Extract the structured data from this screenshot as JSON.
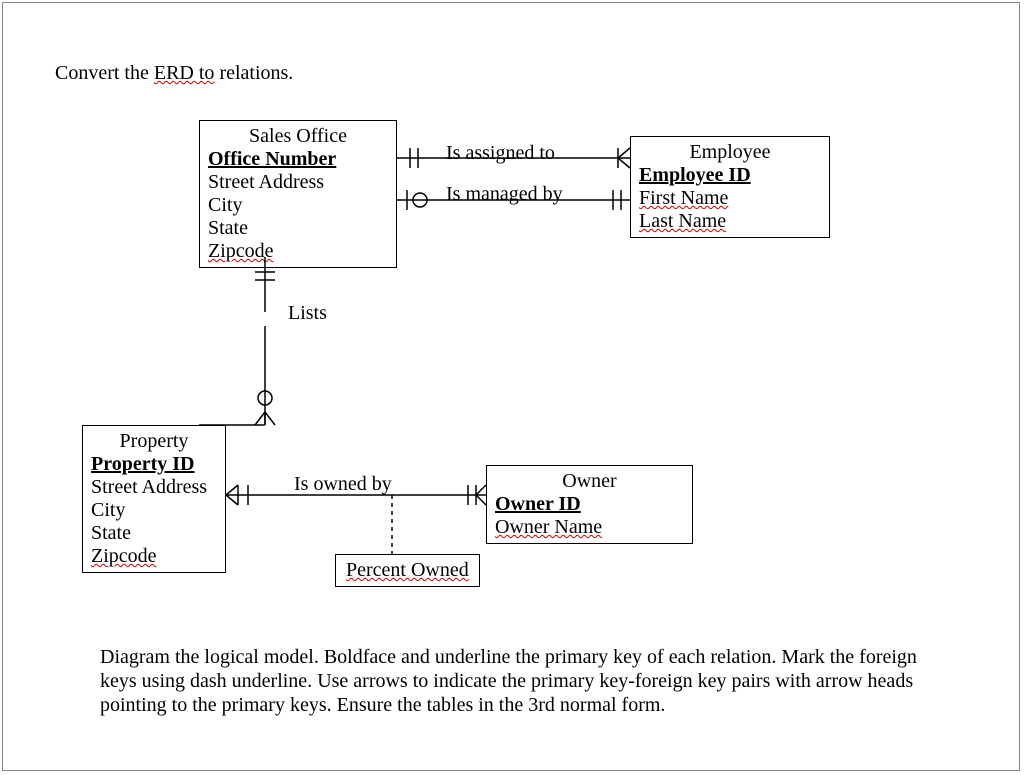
{
  "prompt_prefix": "Convert the ",
  "prompt_spell": "ERD to",
  "prompt_suffix": " relations.",
  "sales_office": {
    "title": "Sales Office",
    "pk": "Office Number",
    "a1": "Street Address",
    "a2": "City",
    "a3": "State",
    "a4_spell": "Zipcode"
  },
  "employee": {
    "title": "Employee",
    "pk": "Employee ID",
    "a1_spell": "First Name",
    "a2_spell": "Last Name"
  },
  "property": {
    "title": "Property",
    "pk": "Property ID",
    "a1": "Street Address",
    "a2": "City",
    "a3": "State",
    "a4_spell": "Zipcode"
  },
  "owner": {
    "title": "Owner",
    "pk_spell": "Owner ID",
    "a1_spell": "Owner Name"
  },
  "rels": {
    "assigned": "Is assigned to",
    "managed": "Is managed by",
    "lists": "Lists",
    "owned": "Is owned by",
    "percent_spell": "Percent Owned"
  },
  "instructions": "Diagram the logical model. Boldface and underline the primary key of each relation. Mark the foreign keys using dash underline. Use arrows to indicate the primary key-foreign key pairs with arrow heads pointing to the primary keys. Ensure the tables in the 3rd normal form."
}
